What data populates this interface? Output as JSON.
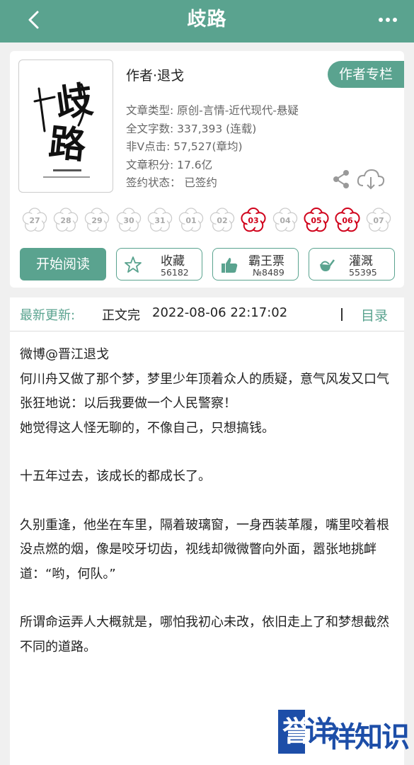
{
  "header": {
    "title": "歧路",
    "back_icon": "chevron-left-icon",
    "more_icon": "more-dots-icon"
  },
  "book": {
    "cover_title": "歧路",
    "author_line": "作者·退戈",
    "author_column_button": "作者专栏",
    "meta": [
      "文章类型: 原创-言情-近代现代-悬疑",
      "全文字数: 337,393 (连载)",
      "非V点击: 57,527(章均)",
      "文章积分: 17.6亿",
      "签约状态： 已签约"
    ],
    "ratings": [
      {
        "label": "27",
        "active": false
      },
      {
        "label": "28",
        "active": false
      },
      {
        "label": "29",
        "active": false
      },
      {
        "label": "30",
        "active": false
      },
      {
        "label": "31",
        "active": false
      },
      {
        "label": "01",
        "active": false
      },
      {
        "label": "02",
        "active": false
      },
      {
        "label": "03",
        "active": true
      },
      {
        "label": "04",
        "active": false
      },
      {
        "label": "05",
        "active": true
      },
      {
        "label": "06",
        "active": true
      },
      {
        "label": "07",
        "active": false
      }
    ]
  },
  "actions": {
    "start_reading": "开始阅读",
    "favorite": {
      "label": "收藏",
      "count": "56182",
      "icon": "star-icon"
    },
    "overlord_ticket": {
      "label": "霸王票",
      "count": "№8489",
      "icon": "thumbs-up-icon"
    },
    "irrigate": {
      "label": "灌溉",
      "count": "55395",
      "icon": "watering-can-icon"
    }
  },
  "update": {
    "label": "最新更新:",
    "status": "正文完",
    "time": "2022-08-06 22:17:02",
    "toc": "目录"
  },
  "body_text": {
    "p1": "微博@晋江退戈",
    "p2": "何川舟又做了那个梦，梦里少年顶着众人的质疑，意气风发又口气张狂地说：以后我要做一个人民警察！",
    "p3": "她觉得这人怪无聊的，不像自己，只想搞钱。",
    "p4": "十五年过去，该成长的都成长了。",
    "p5": "久别重逢，他坐在车里，隔着玻璃窗，一身西装革履，嘴里咬着根没点燃的烟，像是咬牙切齿，视线却微微瞥向外面，嚣张地挑衅道：“哟，何队。”",
    "p6": "所谓命运弄人大概就是，哪怕我初心未改，依旧走上了和梦想截然不同的道路。"
  },
  "watermark": {
    "box1": "誉",
    "box2": "详",
    "text": "祥知识"
  },
  "colors": {
    "accent": "#5aa38f",
    "rating_active": "#d0021b",
    "rating_inactive": "#cccccc",
    "watermark": "#1d4ea8"
  }
}
